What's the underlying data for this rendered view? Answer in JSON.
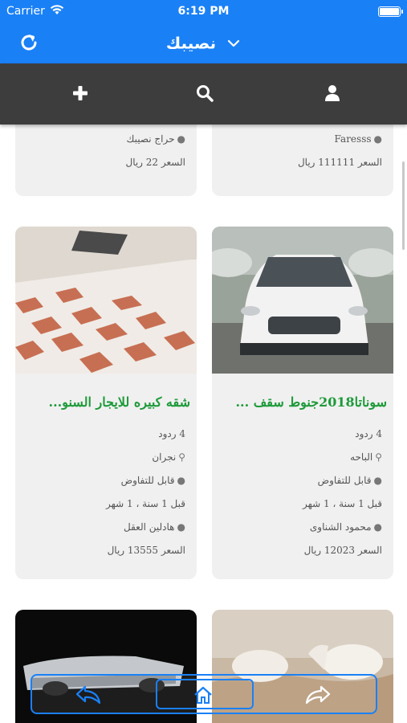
{
  "status_bar": {
    "carrier": "Carrier",
    "time": "6:19 PM"
  },
  "nav": {
    "title": "نصيبك"
  },
  "toolbar": {
    "icons": [
      "plus-icon",
      "search-icon",
      "user-icon"
    ]
  },
  "top_cards": [
    {
      "seller": "حراج نصيبك",
      "price": "السعر 22 ريال"
    },
    {
      "seller": "Faresss",
      "price": "السعر 111111 ريال"
    }
  ],
  "listings": [
    {
      "title": "سوناتا2018جنوط سقف ...",
      "replies": "4 ردود",
      "location": "الباحه",
      "negotiable": "قابل للتفاوض",
      "time_ago": "قبل 1 سنة ، 1 شهر",
      "seller": "محمود الشناوى",
      "price": "السعر 12023 ريال"
    },
    {
      "title": "شقه كبيره للايجار السنو...",
      "replies": "4 ردود",
      "location": "نجران",
      "negotiable": "قابل للتفاوض",
      "time_ago": "قبل 1 سنة ، 1 شهر",
      "seller": "هادلين العقل",
      "price": "السعر 13555 ريال"
    }
  ],
  "colors": {
    "primary": "#1a80f6",
    "toolbar": "#3d3d3d",
    "title_green": "#1e9a3a",
    "card_bg": "#f0f0f0"
  }
}
